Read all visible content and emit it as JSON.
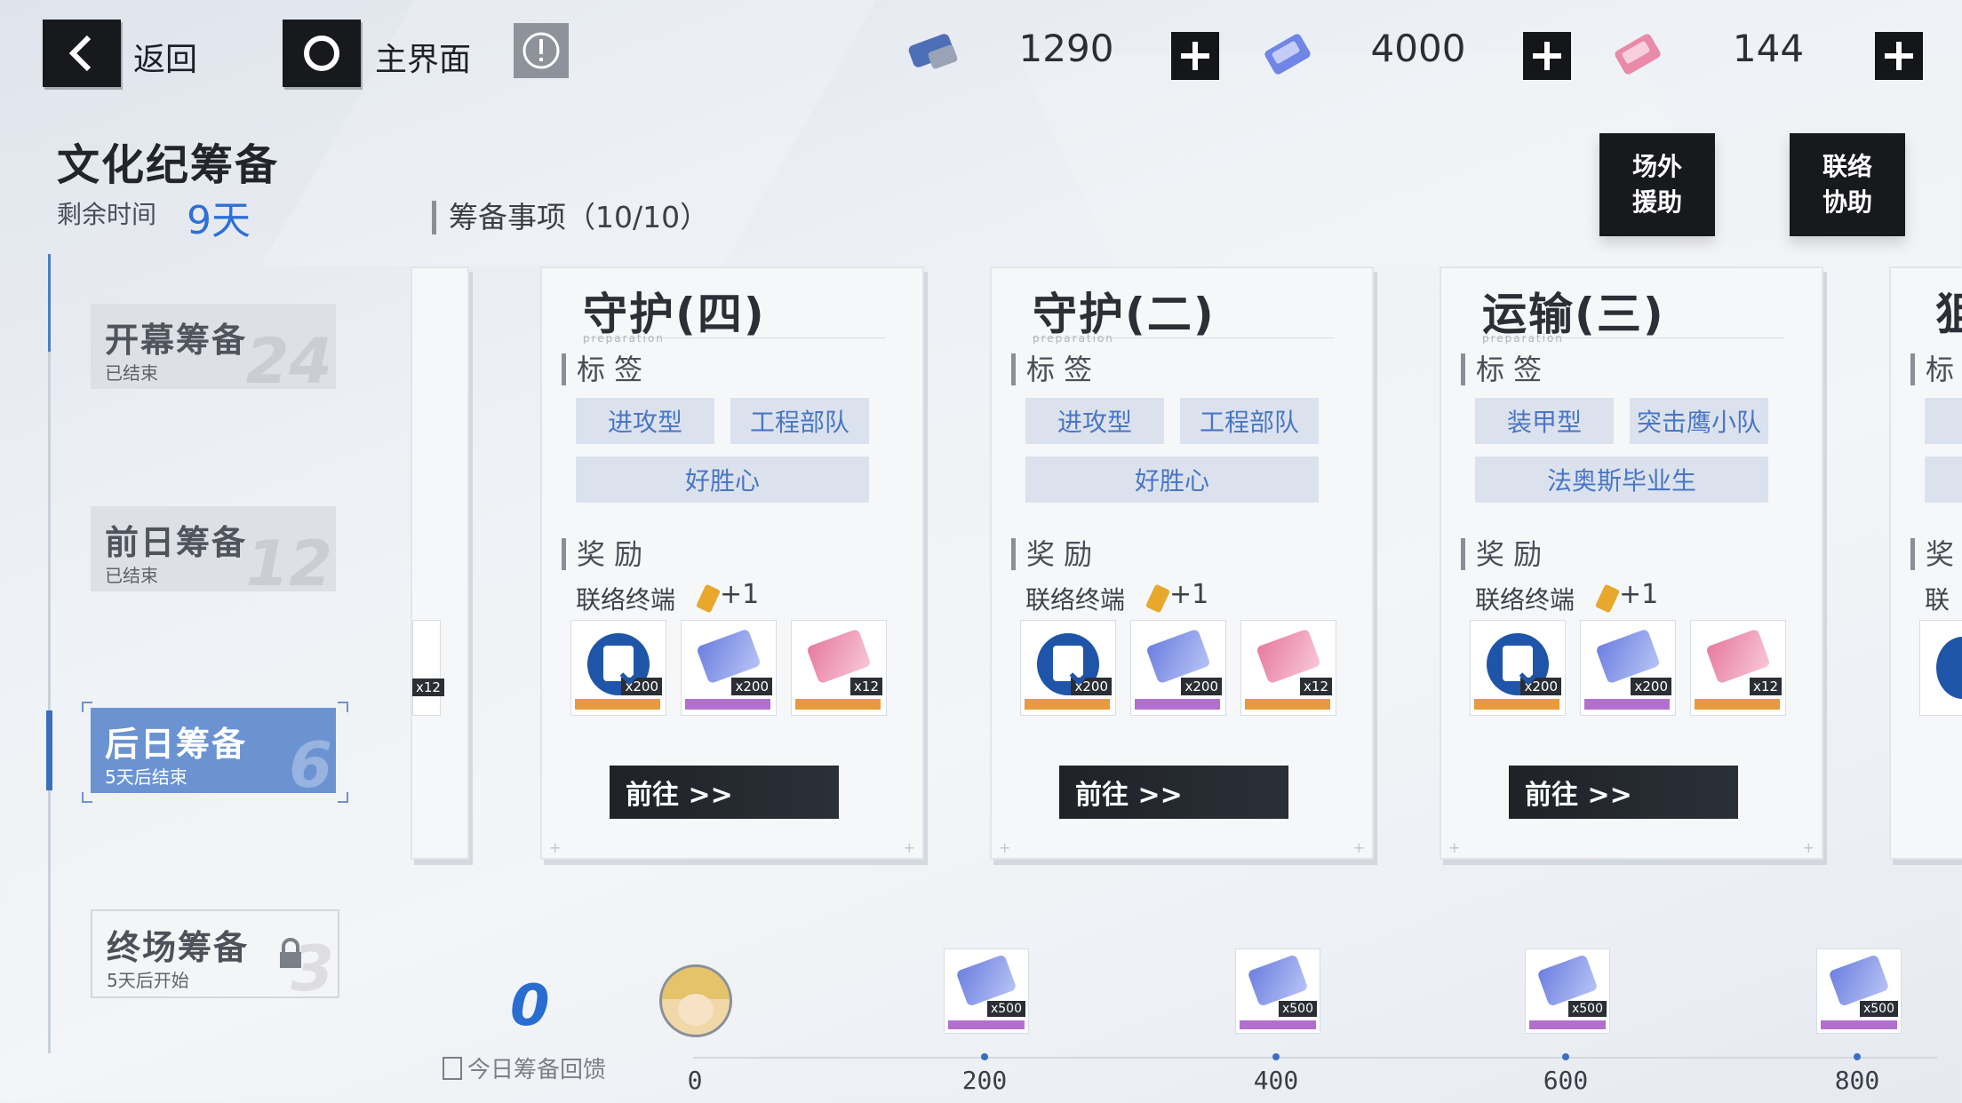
{
  "topbar": {
    "back_label": "返回",
    "home_label": "主界面",
    "resources": [
      {
        "icon": "pass-ticket-icon",
        "value": "1290"
      },
      {
        "icon": "blue-supply-ticket-icon",
        "value": "4000"
      },
      {
        "icon": "pink-supply-ticket-icon",
        "value": "144"
      }
    ]
  },
  "event": {
    "title": "文化纪筹备",
    "remaining_label": "剩余时间",
    "remaining_value": "9天"
  },
  "side_buttons": {
    "outside_aid": "场外\n援助",
    "contact_assist": "联络\n协助"
  },
  "phases": [
    {
      "name": "开幕筹备",
      "status": "已结束",
      "number": "24",
      "state": "ended"
    },
    {
      "name": "前日筹备",
      "status": "已结束",
      "number": "12",
      "state": "ended"
    },
    {
      "name": "后日筹备",
      "status": "5天后结束",
      "number": "6",
      "state": "active"
    },
    {
      "name": "终场筹备",
      "status": "5天后开始",
      "number": "3",
      "state": "locked"
    }
  ],
  "tasks_header": "筹备事项（10/10）",
  "card_labels": {
    "tags_label": "标 签",
    "rewards_label": "奖 励",
    "terminal_label": "联络终端",
    "terminal_bonus": "+1",
    "go_label": "前往 >>",
    "subtitle": "preparation"
  },
  "cards": [
    {
      "title": "守护(四)",
      "tags": [
        "进攻型",
        "工程部队",
        "好胜心"
      ],
      "rewards": [
        {
          "icon": "clipboard-icon",
          "count": "x200"
        },
        {
          "icon": "blue-supply-ticket-icon",
          "count": "x200"
        },
        {
          "icon": "pink-supply-ticket-icon",
          "count": "x12"
        }
      ]
    },
    {
      "title": "守护(二)",
      "tags": [
        "进攻型",
        "工程部队",
        "好胜心"
      ],
      "rewards": [
        {
          "icon": "clipboard-icon",
          "count": "x200"
        },
        {
          "icon": "blue-supply-ticket-icon",
          "count": "x200"
        },
        {
          "icon": "pink-supply-ticket-icon",
          "count": "x12"
        }
      ]
    },
    {
      "title": "运输(三)",
      "tags": [
        "装甲型",
        "突击鹰小队",
        "法奥斯毕业生"
      ],
      "rewards": [
        {
          "icon": "clipboard-icon",
          "count": "x200"
        },
        {
          "icon": "blue-supply-ticket-icon",
          "count": "x200"
        },
        {
          "icon": "pink-supply-ticket-icon",
          "count": "x12"
        }
      ]
    }
  ],
  "right_partial": {
    "title_char": "狙",
    "tags_char": "标",
    "rewards_char": "奖",
    "terminal_char": "联"
  },
  "left_partial": {
    "count": "x12"
  },
  "progress": {
    "value": "0",
    "label": "今日筹备回馈",
    "ticks": [
      "0",
      "200",
      "400",
      "600",
      "800"
    ],
    "milestone_count": "x500"
  },
  "colors": {
    "accent": "#2f6fd6",
    "active_phase": "#6b93d2",
    "tag_bg": "#dbe2ee",
    "tag_text": "#4a76c4"
  }
}
